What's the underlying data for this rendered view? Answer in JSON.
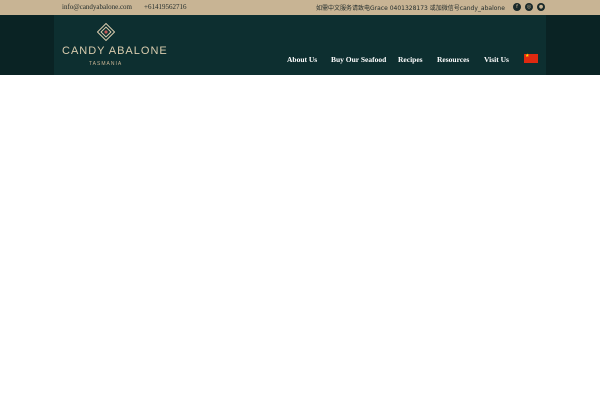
{
  "topbar": {
    "email": "info@candyabalone.com",
    "phone": "+61419562716",
    "chinese_notice": "如需中文服务请致电Grace 0401328173 或加微信号candy_abalone",
    "social_icons": [
      "facebook-icon",
      "instagram-icon",
      "wechat-icon"
    ]
  },
  "logo": {
    "brand": "CANDY ABALONE",
    "sub": "TASMANIA"
  },
  "nav": {
    "items": [
      "About Us",
      "Buy Our Seafood",
      "Recipes",
      "Resources",
      "Visit Us"
    ],
    "language_flag": "china-flag-icon"
  },
  "colors": {
    "topbar_bg": "#c8b494",
    "navbar_bg": "#0d2f30",
    "accent_gold": "#d9ccae"
  }
}
